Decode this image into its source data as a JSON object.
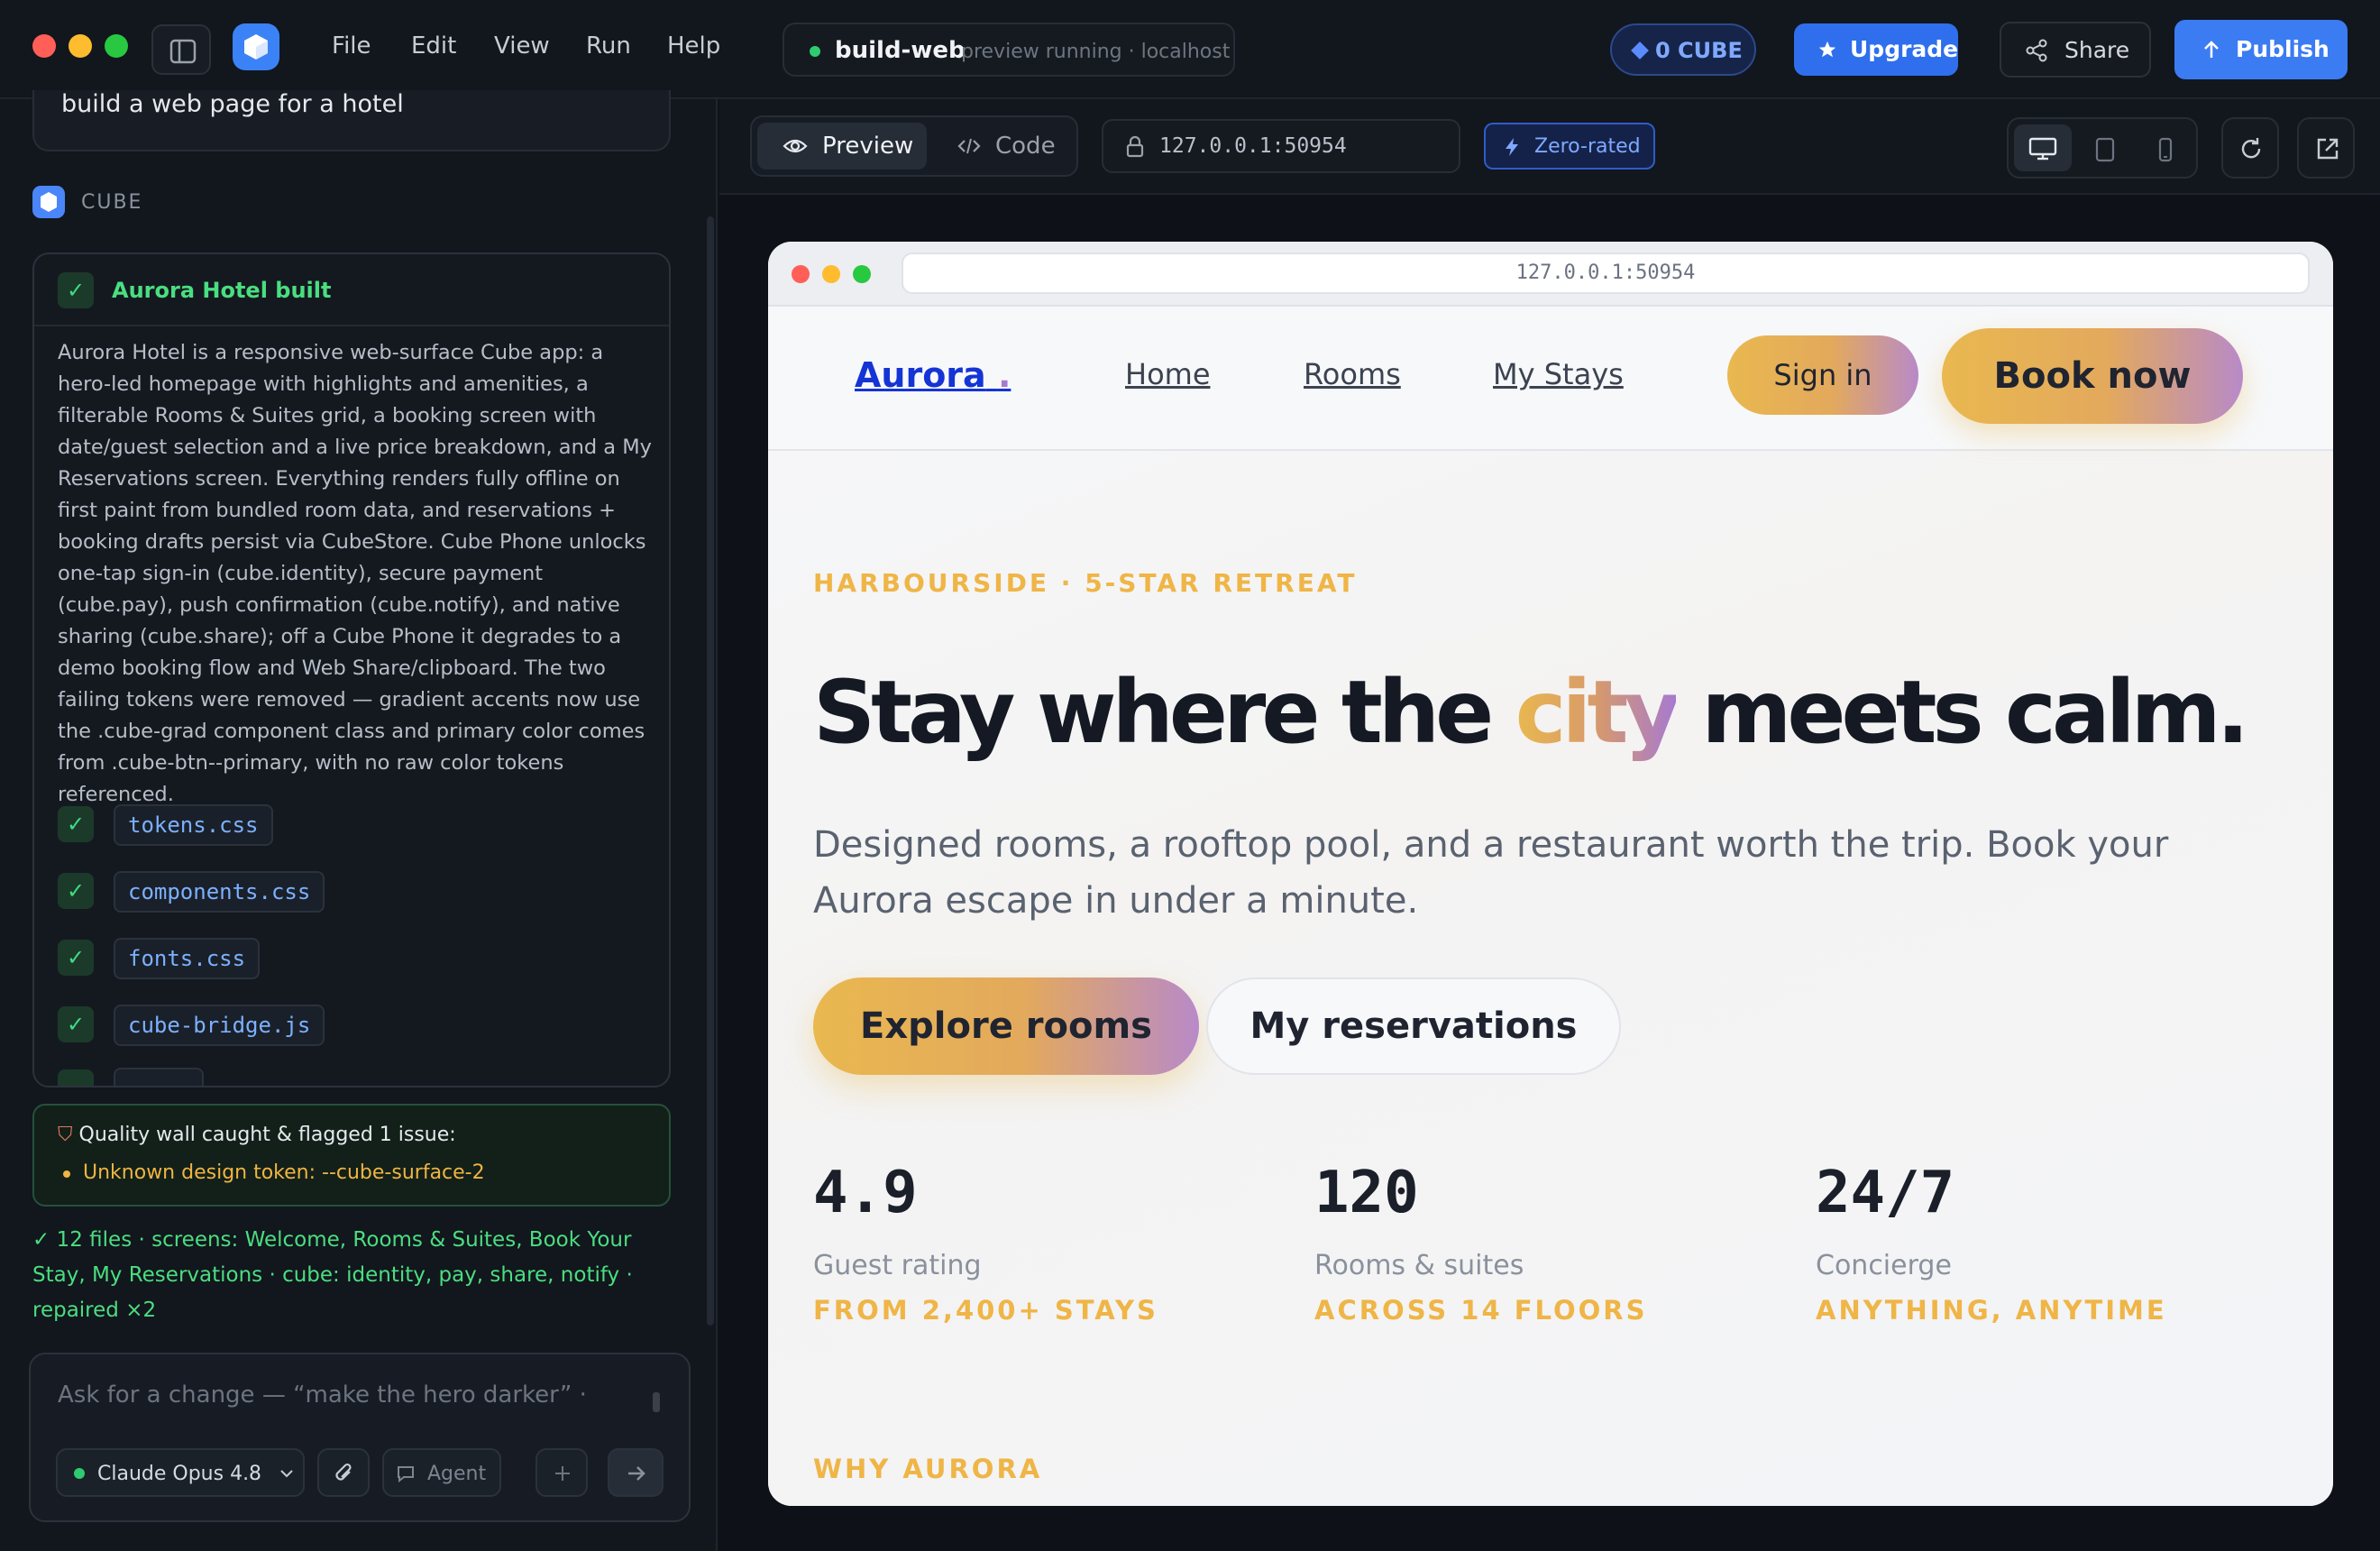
{
  "titlebar": {
    "menu": [
      "File",
      "Edit",
      "View",
      "Run",
      "Help"
    ],
    "project_name": "build-web",
    "project_status": "preview running · localhost",
    "cube_balance": "0 CUBE",
    "upgrade_label": "Upgrade",
    "share_label": "Share",
    "publish_label": "Publish"
  },
  "chat": {
    "user_prompt": "build a web page for a hotel",
    "agent_name": "CUBE",
    "result_title": "Aurora Hotel built",
    "result_description": "Aurora Hotel is a responsive web-surface Cube app: a hero-led homepage with highlights and amenities, a filterable Rooms & Suites grid, a booking screen with date/guest selection and a live price breakdown, and a My Reservations screen. Everything renders fully offline on first paint from bundled room data, and reservations + booking drafts persist via CubeStore. Cube Phone unlocks one-tap sign-in (cube.identity), secure payment (cube.pay), push confirmation (cube.notify), and native sharing (cube.share); off a Cube Phone it degrades to a demo booking flow and Web Share/clipboard. The two failing tokens were removed — gradient accents now use the .cube-grad component class and primary color comes from .cube-btn--primary, with no raw color tokens referenced.",
    "files": [
      "tokens.css",
      "components.css",
      "fonts.css",
      "cube-bridge.js"
    ],
    "quality_title": "Quality wall caught & flagged 1 issue:",
    "quality_issue": "Unknown design token: --cube-surface-2",
    "summary": "✓ 12 files · screens: Welcome, Rooms & Suites, Book Your Stay, My Reservations · cube: identity, pay, share, notify · repaired ×2",
    "composer_placeholder": "Ask for a change — “make the hero darker”  ·",
    "model_label": "Claude Opus 4.8",
    "agent_mode_label": "Agent"
  },
  "workspace": {
    "tab_preview": "Preview",
    "tab_code": "Code",
    "address": "127.0.0.1:50954",
    "network_badge": "Zero-rated"
  },
  "site": {
    "address": "127.0.0.1:50954",
    "brand": "Aurora",
    "brand_dot": ".",
    "nav": [
      "Home",
      "Rooms",
      "My Stays"
    ],
    "signin_label": "Sign in",
    "book_label": "Book now",
    "eyebrow": "HARBOURSIDE · 5-STAR RETREAT",
    "hero_before": "Stay where the ",
    "hero_highlight": "city",
    "hero_after": " meets calm.",
    "lede": "Designed rooms, a rooftop pool, and a restaurant worth the trip. Book your Aurora escape in under a minute.",
    "cta_primary": "Explore rooms",
    "cta_secondary": "My reservations",
    "stats": [
      {
        "value": "4.9",
        "label": "Guest rating",
        "detail": "FROM 2,400+ STAYS"
      },
      {
        "value": "120",
        "label": "Rooms & suites",
        "detail": "ACROSS 14 FLOORS"
      },
      {
        "value": "24/7",
        "label": "Concierge",
        "detail": "ANYTHING, ANYTIME"
      }
    ],
    "section_label": "WHY AURORA"
  },
  "colors": {
    "accent_blue": "#3c7cf2",
    "success_green": "#4ade80",
    "warning_amber": "#f0b442",
    "site_gold": "#efb546",
    "site_gradient_end": "#b88ac8"
  }
}
